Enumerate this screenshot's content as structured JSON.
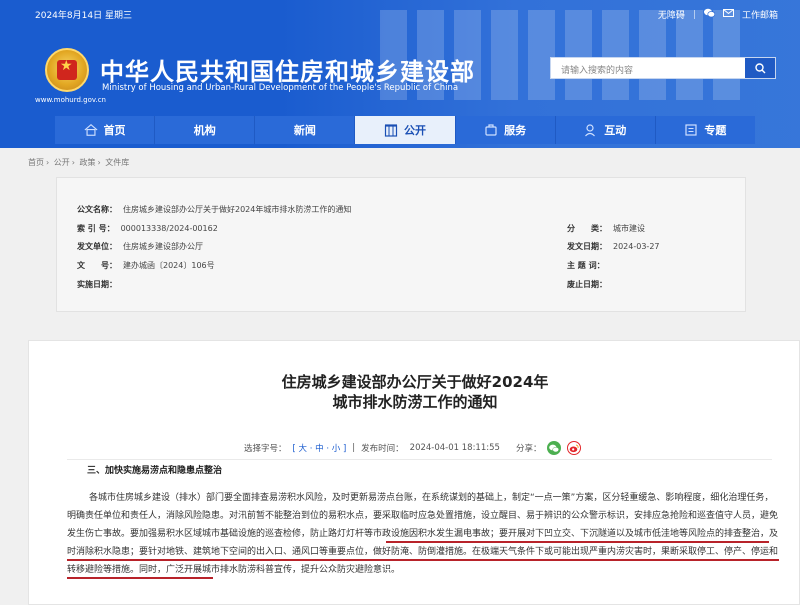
{
  "header": {
    "date": "2024年8月14日 星期三",
    "top_links": [
      "无障碍",
      "工作邮箱"
    ],
    "site_title_cn": "中华人民共和国住房和城乡建设部",
    "site_title_en": "Ministry of Housing and Urban-Rural Development of the People's Republic of China",
    "site_url": "www.mohurd.gov.cn",
    "search_placeholder": "请输入搜索的内容",
    "colors": {
      "primary": "#1a5ccf",
      "nav_active_bg": "#e8f0fb",
      "highlight": "#b8232a"
    }
  },
  "nav": {
    "items": [
      {
        "label": "首页",
        "icon": "home-icon"
      },
      {
        "label": "机构",
        "icon": ""
      },
      {
        "label": "新闻",
        "icon": ""
      },
      {
        "label": "公开",
        "icon": "building-icon",
        "active": true
      },
      {
        "label": "服务",
        "icon": "service-icon"
      },
      {
        "label": "互动",
        "icon": "chat-icon"
      },
      {
        "label": "专题",
        "icon": "topic-icon"
      }
    ]
  },
  "breadcrumb": [
    "首页",
    "公开",
    "政策",
    "文件库"
  ],
  "info": {
    "title_label": "公文名称：",
    "title_value": "住房城乡建设部办公厅关于做好2024年城市排水防涝工作的通知",
    "index_label": "索 引 号：",
    "index_value": "000013338/2024-00162",
    "issuer_label": "发文单位：",
    "issuer_value": "住房城乡建设部办公厅",
    "docno_label": "文　　号：",
    "docno_value": "建办城函〔2024〕106号",
    "effective_label": "实施日期：",
    "effective_value": "",
    "category_label": "分　　类：",
    "category_value": "城市建设",
    "date_label": "发文日期：",
    "date_value": "2024-03-27",
    "theme_label": "主 题 词：",
    "theme_value": "",
    "expire_label": "废止日期：",
    "expire_value": ""
  },
  "article": {
    "title_line1": "住房城乡建设部办公厅关于做好2024年",
    "title_line2": "城市排水防涝工作的通知",
    "font_size_label": "选择字号：",
    "font_size_options": "[ 大 · 中 · 小 ]",
    "publish_label": "发布时间：",
    "publish_time": "2024-04-01 18:11:55",
    "share_label": "分享：",
    "section_heading": "三、加快实施易涝点和隐患点整治",
    "paragraph": "各城市住房城乡建设（排水）部门要全面排查易涝积水风险，及时更新易涝点台账，在系统谋划的基础上，制定“一点一策”方案，区分轻重缓急、影响程度，细化治理任务，明确责任单位和责任人，消除风险隐患。对汛前暂不能整治到位的易积水点，要采取临时应急处置措施，设立醒目、易于辨识的公众警示标识，安排应急抢险和巡查值守人员，避免发生伤亡事故。要加强易积水区域城市基础设施的巡查检修，防止路灯灯杆等市政设施因积水发生漏电事故；要开展对下凹立交、下沉隧道以及城市低洼地等风险点的排查整治，及时消除积水隐患；要针对地铁、建筑地下空间的出入口、通风口等重要点位，做好防淹、防倒灌措施。在极端天气条件下或可能出现严重内涝灾害时，果断采取停工、停产、停运和转移避险等措施。同时，广泛开展城市排水防涝科普宣传，提升公众防灾避险意识。"
  }
}
